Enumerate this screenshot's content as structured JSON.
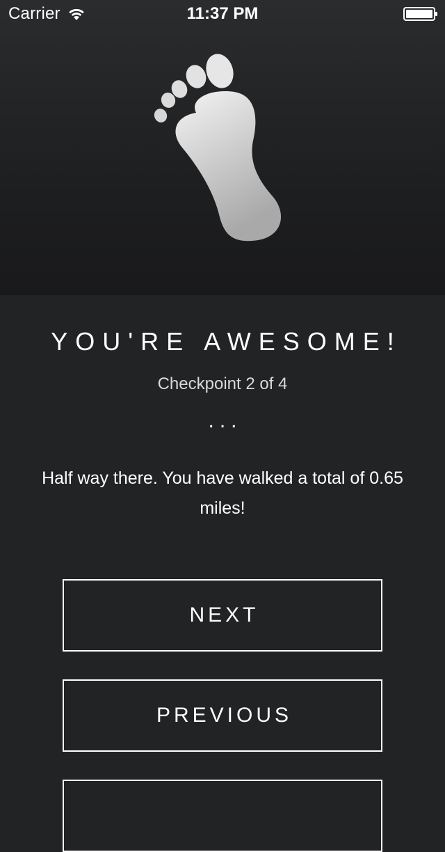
{
  "status_bar": {
    "carrier": "Carrier",
    "time": "11:37 PM",
    "wifi_icon": "wifi-icon",
    "battery_icon": "battery-icon"
  },
  "hero": {
    "icon": "footprint-icon"
  },
  "checkpoint": {
    "title": "YOU'RE AWESOME!",
    "subtitle": "Checkpoint 2 of 4",
    "dots": "...",
    "message": "Half way there. You have walked a total of 0.65 miles!"
  },
  "buttons": {
    "next_label": "NEXT",
    "previous_label": "PREVIOUS",
    "third_label": ""
  },
  "colors": {
    "background": "#222325",
    "text": "#ffffff",
    "subtitle": "#d9d9d9"
  }
}
